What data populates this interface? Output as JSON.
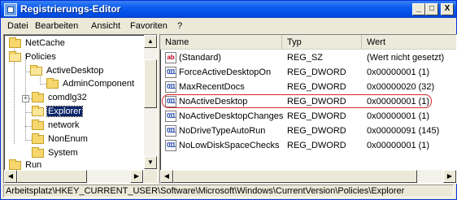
{
  "window": {
    "title": "Registrierungs-Editor"
  },
  "titlebar_buttons": {
    "minimize": "_",
    "maximize": "□",
    "close": "X"
  },
  "menu": [
    "Datei",
    "Bearbeiten",
    "Ansicht",
    "Favoriten",
    "?"
  ],
  "tree": {
    "items": [
      {
        "label": "NetCache"
      },
      {
        "label": "Policies"
      },
      {
        "label": "ActiveDesktop"
      },
      {
        "label": "AdminComponent"
      },
      {
        "label": "comdlg32"
      },
      {
        "label": "Explorer"
      },
      {
        "label": "network"
      },
      {
        "label": "NonEnum"
      },
      {
        "label": "System"
      },
      {
        "label": "Run"
      }
    ],
    "selected": "Explorer"
  },
  "list": {
    "headers": [
      "Name",
      "Typ",
      "Wert"
    ],
    "rows": [
      {
        "icon": "string-value-icon",
        "glyph": "ab",
        "name": "(Standard)",
        "type": "REG_SZ",
        "value": "(Wert nicht gesetzt)"
      },
      {
        "icon": "dword-value-icon",
        "glyph": "011",
        "name": "ForceActiveDesktopOn",
        "type": "REG_DWORD",
        "value": "0x00000001 (1)"
      },
      {
        "icon": "dword-value-icon",
        "glyph": "011",
        "name": "MaxRecentDocs",
        "type": "REG_DWORD",
        "value": "0x00000020 (32)"
      },
      {
        "icon": "dword-value-icon",
        "glyph": "011",
        "name": "NoActiveDesktop",
        "type": "REG_DWORD",
        "value": "0x00000001 (1)"
      },
      {
        "icon": "dword-value-icon",
        "glyph": "011",
        "name": "NoActiveDesktopChanges",
        "type": "REG_DWORD",
        "value": "0x00000001 (1)"
      },
      {
        "icon": "dword-value-icon",
        "glyph": "011",
        "name": "NoDriveTypeAutoRun",
        "type": "REG_DWORD",
        "value": "0x00000091 (145)"
      },
      {
        "icon": "dword-value-icon",
        "glyph": "011",
        "name": "NoLowDiskSpaceChecks",
        "type": "REG_DWORD",
        "value": "0x00000001 (1)"
      }
    ],
    "highlighted_row": "NoActiveDesktop"
  },
  "statusbar": {
    "path": "Arbeitsplatz\\HKEY_CURRENT_USER\\Software\\Microsoft\\Windows\\CurrentVersion\\Policies\\Explorer"
  },
  "colors": {
    "titlebar": "#0a5cf0",
    "selection": "#0a246a",
    "highlight_ring": "#d9262c"
  }
}
